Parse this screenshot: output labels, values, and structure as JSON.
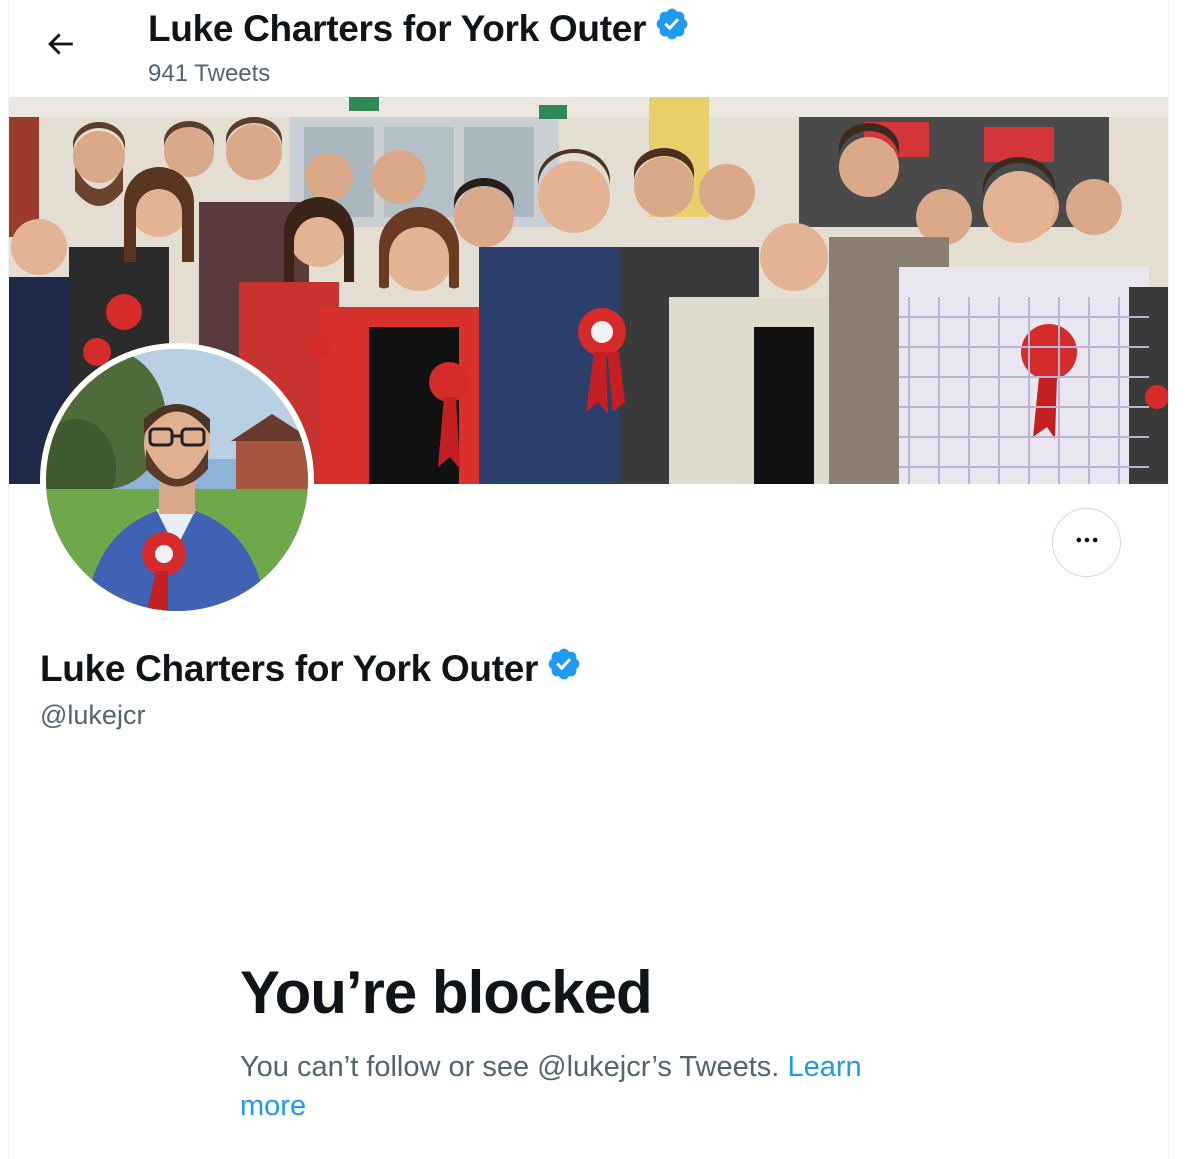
{
  "header": {
    "title": "Luke Charters for York Outer",
    "tweet_count": "941 Tweets"
  },
  "profile": {
    "name": "Luke Charters for York Outer",
    "handle": "@lukejcr",
    "verified": true
  },
  "blocked": {
    "title": "You’re blocked",
    "message": "You can’t follow or see @lukejcr’s Tweets.",
    "learn_more": "Learn more"
  },
  "icons": {
    "back": "arrow-left-icon",
    "verified": "verified-badge-icon",
    "more": "more-horizontal-icon"
  },
  "colors": {
    "accent": "#1d9bf0",
    "secondary_text": "#536471",
    "primary_text": "#0f1419"
  }
}
